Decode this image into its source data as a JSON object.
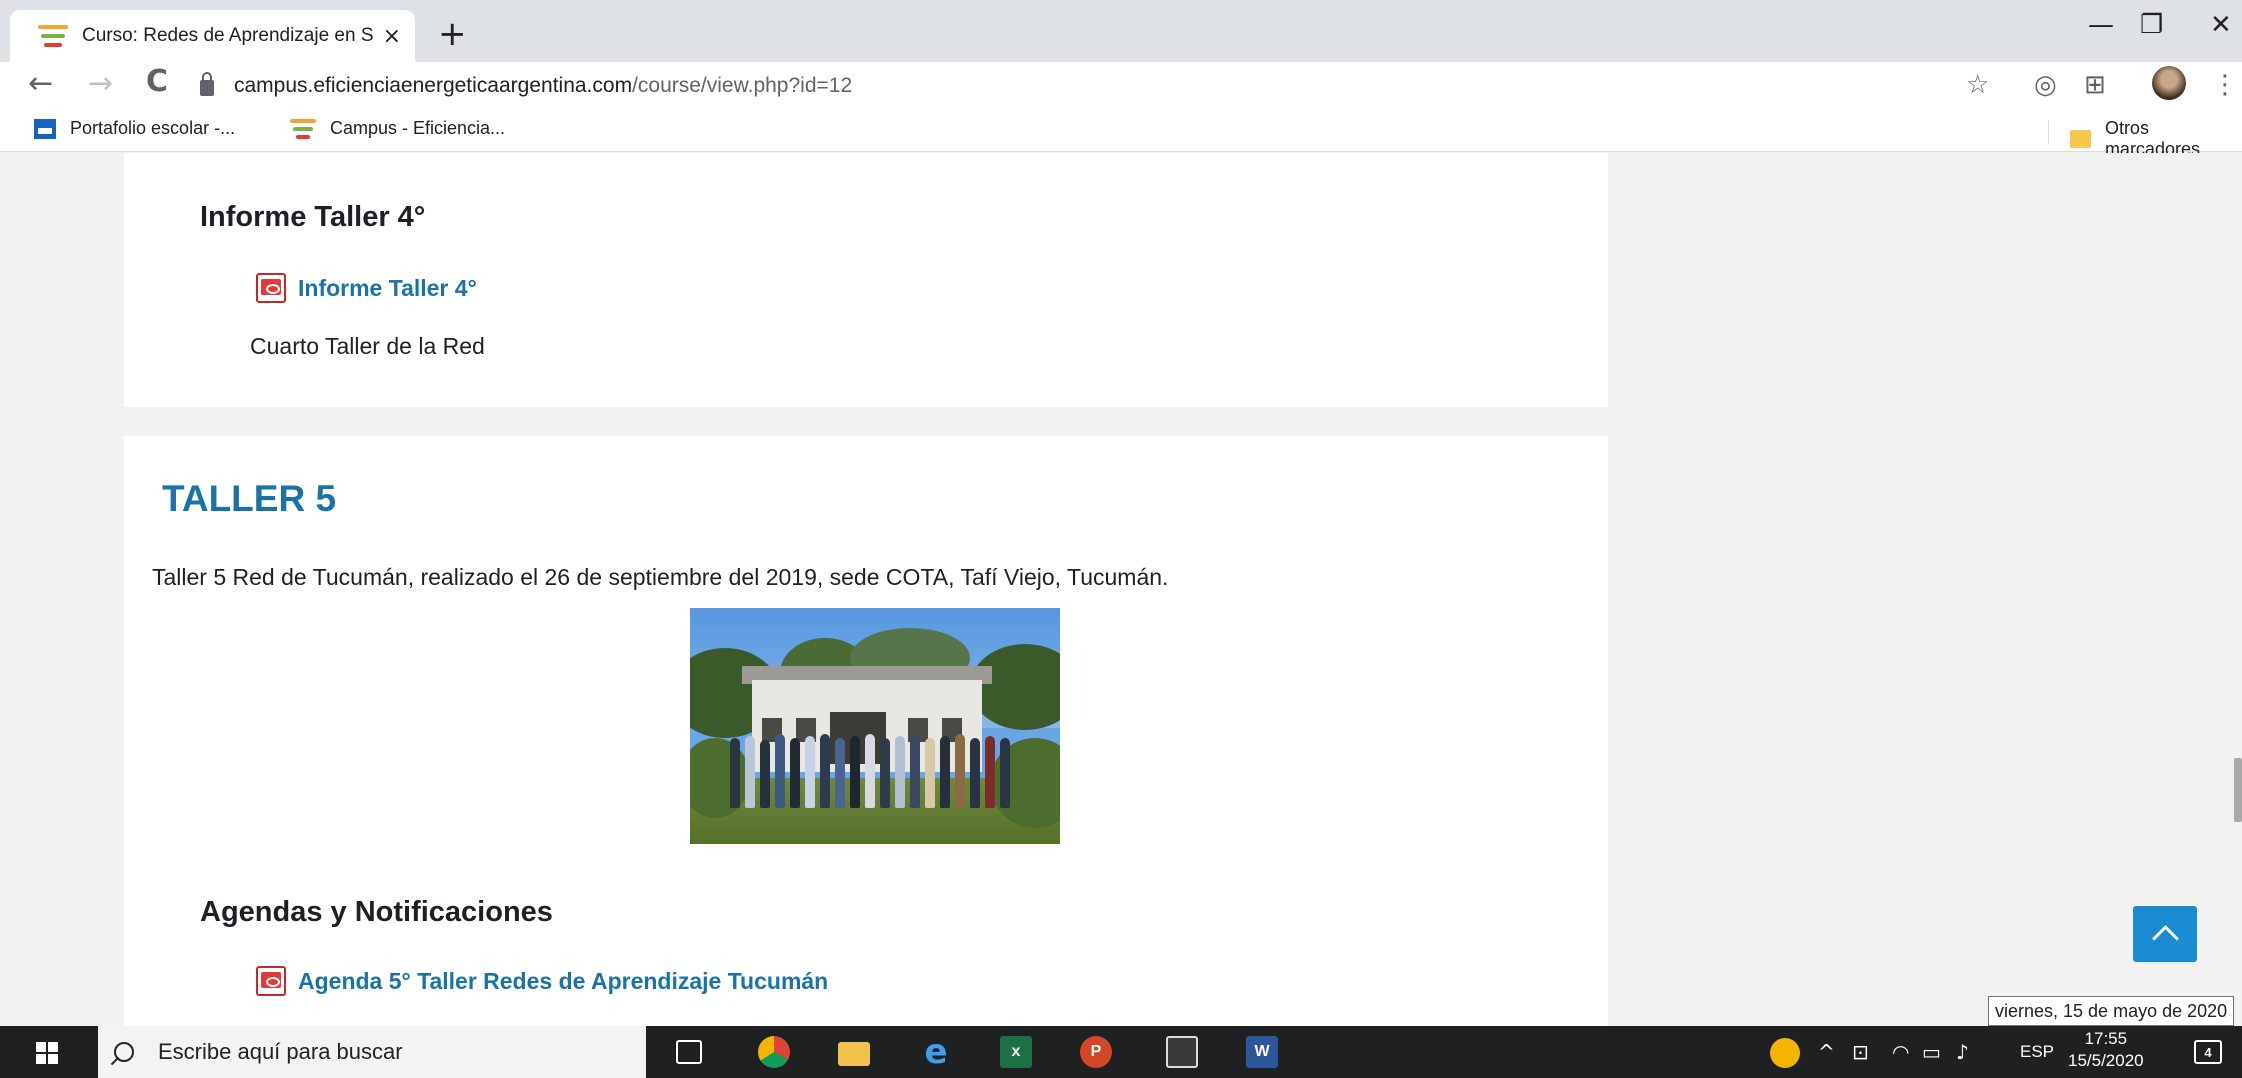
{
  "browser": {
    "tab_title": "Curso: Redes de Aprendizaje en S",
    "tab_close": "×",
    "new_tab": "+",
    "window_controls": {
      "minimize": "—",
      "restore": "❐",
      "close": "✕"
    },
    "nav": {
      "back": "←",
      "forward": "→",
      "reload": "C"
    },
    "url_host": "campus.eficienciaenergeticaargentina.com",
    "url_path": "/course/view.php?id=12",
    "star": "☆",
    "extensions": [
      "◎",
      "⊞"
    ],
    "menu": "⋮",
    "bookmarks": [
      {
        "label": "Portafolio escolar -..."
      },
      {
        "label": "Campus - Eficiencia..."
      }
    ],
    "other_bookmarks": "Otros marcadores"
  },
  "page": {
    "section4": {
      "heading": "Informe Taller 4°",
      "resource_link": "Informe Taller 4°",
      "resource_desc": "Cuarto Taller de la Red"
    },
    "section5": {
      "title": "TALLER 5",
      "summary": "Taller 5 Red de Tucumán, realizado el 26 de septiembre del 2019, sede COTA, Tafí Viejo, Tucumán.",
      "subheading": "Agendas y Notificaciones",
      "resource_link": "Agenda 5° Taller Redes de Aprendizaje Tucumán"
    }
  },
  "tooltip": "viernes, 15 de mayo de 2020",
  "taskbar": {
    "search_placeholder": "Escribe aquí para buscar",
    "apps": [
      "task-view",
      "chrome",
      "file-explorer",
      "edge",
      "excel",
      "powerpoint",
      "calculator",
      "word"
    ],
    "language": "ESP",
    "time": "17:55",
    "date": "15/5/2020",
    "notifications_count": "4"
  },
  "colors": {
    "link_blue": "#1a73a8",
    "scroll_to_top": "#1a8bd0",
    "taskbar": "#1f2021"
  }
}
